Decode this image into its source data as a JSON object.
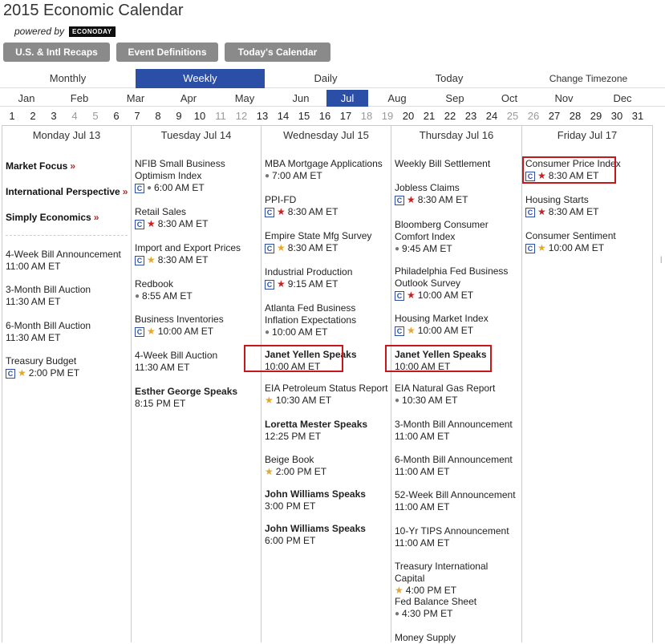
{
  "header": {
    "title": "2015 Economic Calendar",
    "powered_by": "powered by",
    "logo_text": "ECONODAY"
  },
  "buttons": [
    {
      "label": "U.S. & Intl Recaps"
    },
    {
      "label": "Event Definitions"
    },
    {
      "label": "Today's Calendar"
    }
  ],
  "view_tabs": [
    {
      "label": "Monthly",
      "active": false
    },
    {
      "label": "Weekly",
      "active": true
    },
    {
      "label": "Daily",
      "active": false
    },
    {
      "label": "Today",
      "active": false
    },
    {
      "label": "Change Timezone",
      "active": false
    }
  ],
  "months": [
    "Jan",
    "Feb",
    "Mar",
    "Apr",
    "May",
    "Jun",
    "Jul",
    "Aug",
    "Sep",
    "Oct",
    "Nov",
    "Dec"
  ],
  "active_month": "Jul",
  "days": [
    "1",
    "2",
    "3",
    "4",
    "5",
    "6",
    "7",
    "8",
    "9",
    "10",
    "11",
    "12",
    "13",
    "14",
    "15",
    "16",
    "17",
    "18",
    "19",
    "20",
    "21",
    "22",
    "23",
    "24",
    "25",
    "26",
    "27",
    "28",
    "29",
    "30",
    "31"
  ],
  "weekend_days": [
    "4",
    "5",
    "11",
    "12",
    "18",
    "19",
    "25",
    "26"
  ],
  "columns": [
    {
      "header": "Monday Jul 13",
      "focus_links": [
        "Market Focus",
        "International Perspective",
        "Simply Economics"
      ],
      "events": [
        {
          "name": "4-Week Bill Announcement",
          "time": "11:00 AM ET"
        },
        {
          "name": "3-Month Bill Auction",
          "time": "11:30 AM ET"
        },
        {
          "name": "6-Month Bill Auction",
          "time": "11:30 AM ET"
        },
        {
          "name": "Treasury Budget",
          "time": "2:00 PM ET"
        }
      ]
    },
    {
      "header": "Tuesday Jul 14",
      "events": [
        {
          "name": "NFIB Small Business Optimism Index",
          "time": "6:00 AM ET"
        },
        {
          "name": "Retail Sales",
          "time": "8:30 AM ET"
        },
        {
          "name": "Import and Export Prices",
          "time": "8:30 AM ET"
        },
        {
          "name": "Redbook",
          "time": "8:55 AM ET"
        },
        {
          "name": "Business Inventories",
          "time": "10:00 AM ET"
        },
        {
          "name": "4-Week Bill Auction",
          "time": "11:30 AM ET"
        },
        {
          "name": "Esther George Speaks",
          "time": "8:15 PM ET"
        }
      ]
    },
    {
      "header": "Wednesday Jul 15",
      "events": [
        {
          "name": "MBA Mortgage Applications",
          "time": "7:00 AM ET"
        },
        {
          "name": "PPI-FD",
          "time": "8:30 AM ET"
        },
        {
          "name": "Empire State Mfg Survey",
          "time": "8:30 AM ET"
        },
        {
          "name": "Industrial Production",
          "time": "9:15 AM ET"
        },
        {
          "name": "Atlanta Fed Business Inflation Expectations",
          "time": "10:00 AM ET"
        },
        {
          "name": "Janet Yellen Speaks",
          "time": "10:00 AM ET"
        },
        {
          "name": "EIA Petroleum Status Report",
          "time": "10:30 AM ET"
        },
        {
          "name": "Loretta Mester Speaks",
          "time": "12:25 PM ET"
        },
        {
          "name": "Beige Book",
          "time": "2:00 PM ET"
        },
        {
          "name": "John Williams Speaks",
          "time": "3:00 PM ET"
        },
        {
          "name": "John Williams Speaks",
          "time": "6:00 PM ET"
        }
      ]
    },
    {
      "header": "Thursday Jul 16",
      "events": [
        {
          "name": "Weekly Bill Settlement",
          "time": ""
        },
        {
          "name": "Jobless Claims",
          "time": "8:30 AM ET"
        },
        {
          "name": "Bloomberg Consumer Comfort Index",
          "time": "9:45 AM ET"
        },
        {
          "name": "Philadelphia Fed Business Outlook Survey",
          "time": "10:00 AM ET"
        },
        {
          "name": "Housing Market Index",
          "time": "10:00 AM ET"
        },
        {
          "name": "Janet Yellen Speaks",
          "time": "10:00 AM ET"
        },
        {
          "name": "EIA Natural Gas Report",
          "time": "10:30 AM ET"
        },
        {
          "name": "3-Month Bill Announcement",
          "time": "11:00 AM ET"
        },
        {
          "name": "6-Month Bill Announcement",
          "time": "11:00 AM ET"
        },
        {
          "name": "52-Week Bill Announcement",
          "time": "11:00 AM ET"
        },
        {
          "name": "10-Yr TIPS Announcement",
          "time": "11:00 AM ET"
        },
        {
          "name": "Treasury International Capital",
          "time": "4:00 PM ET"
        },
        {
          "name": "Fed Balance Sheet",
          "time": "4:30 PM ET"
        },
        {
          "name": "Money Supply",
          "time": ""
        }
      ]
    },
    {
      "header": "Friday Jul 17",
      "events": [
        {
          "name": "Consumer Price Index",
          "time": "8:30 AM ET"
        },
        {
          "name": "Housing Starts",
          "time": "8:30 AM ET"
        },
        {
          "name": "Consumer Sentiment",
          "time": "10:00 AM ET"
        }
      ]
    }
  ],
  "icons": {
    "c_badge": "C",
    "star": "★",
    "bullet": "●",
    "raquo": "»"
  },
  "colors": {
    "accent": "#2b4ea6",
    "highlight": "#c8161d",
    "star_red": "#c62020",
    "star_gold": "#e3a72b",
    "button_gray": "#8a8a8a"
  }
}
